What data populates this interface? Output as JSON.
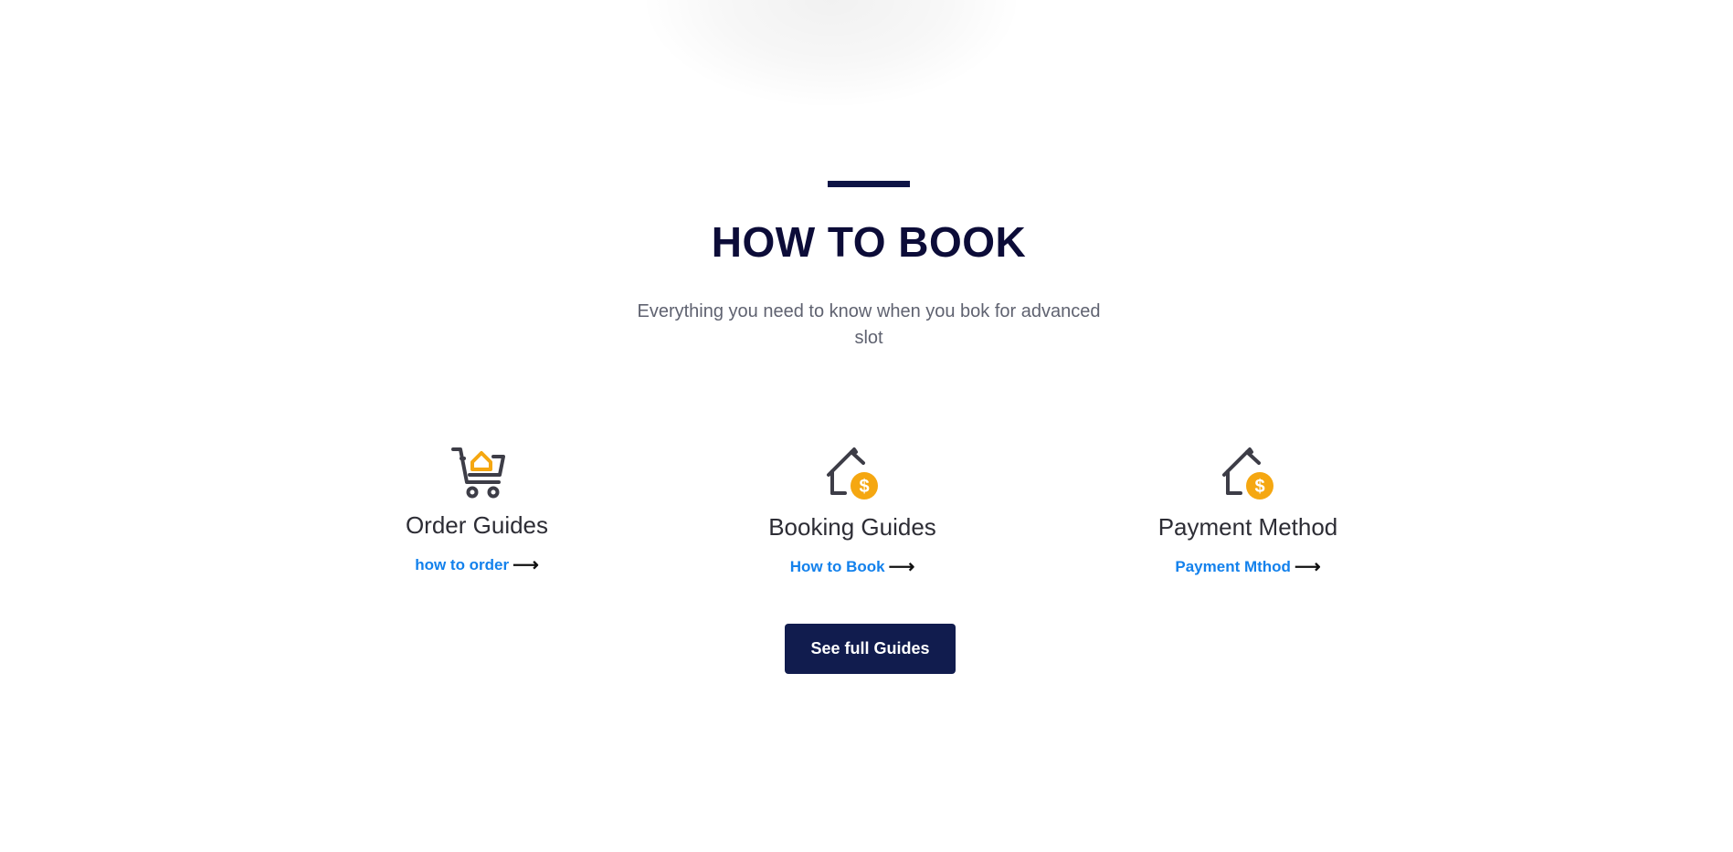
{
  "section": {
    "heading": "HOW TO BOOK",
    "subtitle": "Everything you need to know when you bok for advanced slot"
  },
  "cards": [
    {
      "title": "Order Guides",
      "link_label": "how to order",
      "icon": "cart-house-icon"
    },
    {
      "title": "Booking Guides",
      "link_label": "How to Book",
      "icon": "house-dollar-icon"
    },
    {
      "title": "Payment Method",
      "link_label": "Payment Mthod",
      "icon": "house-dollar-icon"
    }
  ],
  "cta": {
    "label": "See full Guides"
  },
  "colors": {
    "accent_navy": "#0e1446",
    "heading": "#0c0c38",
    "link_blue": "#1381ec",
    "icon_orange": "#f5a711",
    "icon_dark": "#3d3d47",
    "button_bg": "#111c4e"
  }
}
